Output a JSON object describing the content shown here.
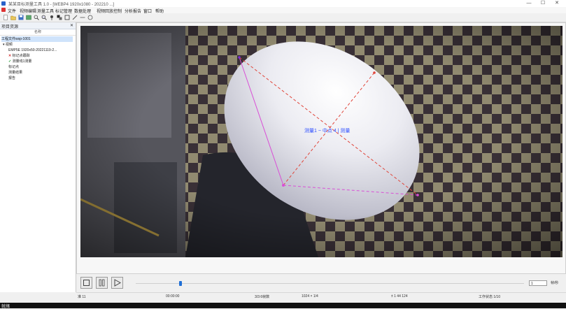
{
  "window": {
    "title": "某某目标测量工具 1.0 - [WEBP4 1920x1080 - 202210 ...]",
    "controls": [
      "—",
      "☐",
      "✕"
    ]
  },
  "menu": [
    "文件",
    "视频编辑",
    "测量工具",
    "标记管理",
    "数据处理",
    "视频回放控制",
    "分析报告",
    "窗口",
    "帮助"
  ],
  "toolbar_icons": [
    "new-icon",
    "open-icon",
    "save-icon",
    "image-icon",
    "search-icon",
    "zoom-icon",
    "pin-icon",
    "select-icon",
    "crop-icon",
    "pen-icon",
    "line-icon",
    "circle-icon"
  ],
  "panel": {
    "title": "项目资源",
    "pin": "✕",
    "column": "名称",
    "tree": [
      {
        "label": "工程文件wsp-1001",
        "indent": 0,
        "mark": "",
        "selected": true
      },
      {
        "label": "视频",
        "indent": 1,
        "mark": "▾"
      },
      {
        "label": "EMP5E 1920x50-20221119-2...",
        "indent": 2,
        "mark": ""
      },
      {
        "label": "标记点跟踪",
        "indent": 2,
        "mark": "✕"
      },
      {
        "label": "测量线1测量",
        "indent": 2,
        "mark": "✓"
      },
      {
        "label": "标记点",
        "indent": 1,
        "mark": ""
      },
      {
        "label": "测量结果",
        "indent": 1,
        "mark": ""
      },
      {
        "label": "报告",
        "indent": 1,
        "mark": ""
      }
    ]
  },
  "viewer": {
    "annotation_label": "测量1 ~ 中点 4 | 测量",
    "annotation_label2": "测量"
  },
  "playback": {
    "rate_value": "1",
    "rate_label": "帧/秒"
  },
  "status": {
    "left": "准 11",
    "field2": "00:00:00",
    "field3": "3/3:6帧数",
    "field4": "1024 × 1/4",
    "field5": "± 1 44   124",
    "field6": "工作状态 1/10",
    "ready": "就绪"
  },
  "colors": {
    "magenta": "#d94fd6",
    "red": "#e0453a",
    "blue": "#2f4fff",
    "accent": "#1f6fd6"
  }
}
